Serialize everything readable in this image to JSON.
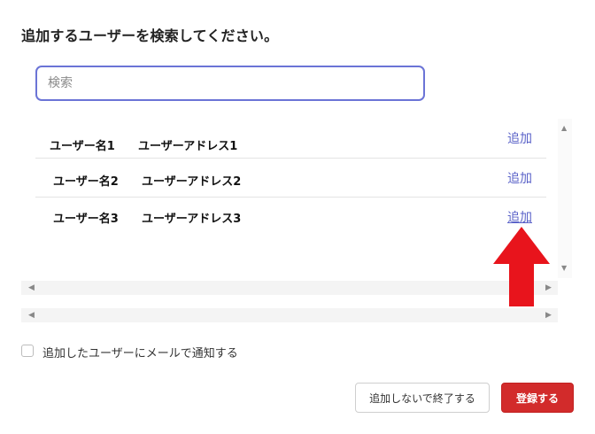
{
  "dialog": {
    "title": "追加するユーザーを検索してください。",
    "search": {
      "placeholder": "検索",
      "value": ""
    },
    "users": [
      {
        "name": "ユーザー名1",
        "address": "ユーザーアドレス1",
        "action": "追加"
      },
      {
        "name": "ユーザー名2",
        "address": "ユーザーアドレス2",
        "action": "追加"
      },
      {
        "name": "ユーザー名3",
        "address": "ユーザーアドレス3",
        "action": "追加"
      }
    ],
    "scrollbar_glyphs": {
      "up": "▲",
      "down": "▼",
      "left": "◀",
      "right": "▶"
    },
    "notify_checkbox": {
      "label": "追加したユーザーにメールで通知する",
      "checked": false
    },
    "buttons": {
      "cancel": "追加しないで終了する",
      "register": "登録する"
    }
  },
  "colors": {
    "accent": "#5a62c8",
    "search_border": "#6b74d6",
    "primary_button": "#d22b2b",
    "annotation_arrow": "#e8141c"
  },
  "annotation": {
    "icon": "red-arrow-up-icon"
  }
}
